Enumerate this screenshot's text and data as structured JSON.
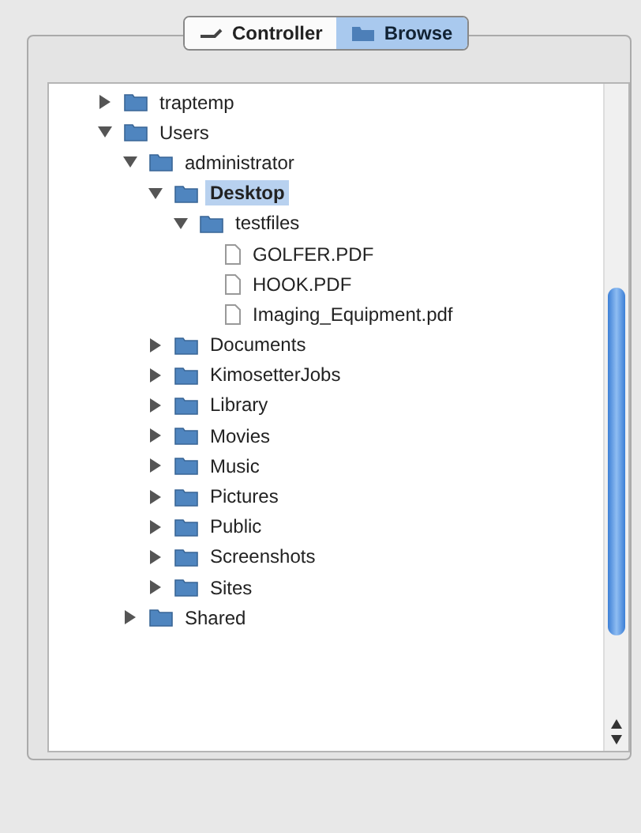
{
  "tabs": [
    {
      "label": "Controller",
      "selected": false
    },
    {
      "label": "Browse",
      "selected": true
    }
  ],
  "tree": [
    {
      "kind": "folder",
      "label": "traptemp",
      "expanded": false,
      "selected": false
    },
    {
      "kind": "folder",
      "label": "Users",
      "expanded": true,
      "selected": false,
      "children": [
        {
          "kind": "folder",
          "label": "administrator",
          "expanded": true,
          "selected": false,
          "children": [
            {
              "kind": "folder",
              "label": "Desktop",
              "expanded": true,
              "selected": true,
              "children": [
                {
                  "kind": "folder",
                  "label": "testfiles",
                  "expanded": true,
                  "selected": false,
                  "children": [
                    {
                      "kind": "file",
                      "label": "GOLFER.PDF",
                      "selected": false
                    },
                    {
                      "kind": "file",
                      "label": "HOOK.PDF",
                      "selected": false
                    },
                    {
                      "kind": "file",
                      "label": "Imaging_Equipment.pdf",
                      "selected": false
                    }
                  ]
                }
              ]
            },
            {
              "kind": "folder",
              "label": "Documents",
              "expanded": false,
              "selected": false
            },
            {
              "kind": "folder",
              "label": "KimosetterJobs",
              "expanded": false,
              "selected": false
            },
            {
              "kind": "folder",
              "label": "Library",
              "expanded": false,
              "selected": false
            },
            {
              "kind": "folder",
              "label": "Movies",
              "expanded": false,
              "selected": false
            },
            {
              "kind": "folder",
              "label": "Music",
              "expanded": false,
              "selected": false
            },
            {
              "kind": "folder",
              "label": "Pictures",
              "expanded": false,
              "selected": false
            },
            {
              "kind": "folder",
              "label": "Public",
              "expanded": false,
              "selected": false
            },
            {
              "kind": "folder",
              "label": "Screenshots",
              "expanded": false,
              "selected": false
            },
            {
              "kind": "folder",
              "label": "Sites",
              "expanded": false,
              "selected": false
            }
          ]
        },
        {
          "kind": "folder",
          "label": "Shared",
          "expanded": false,
          "selected": false
        }
      ]
    }
  ]
}
